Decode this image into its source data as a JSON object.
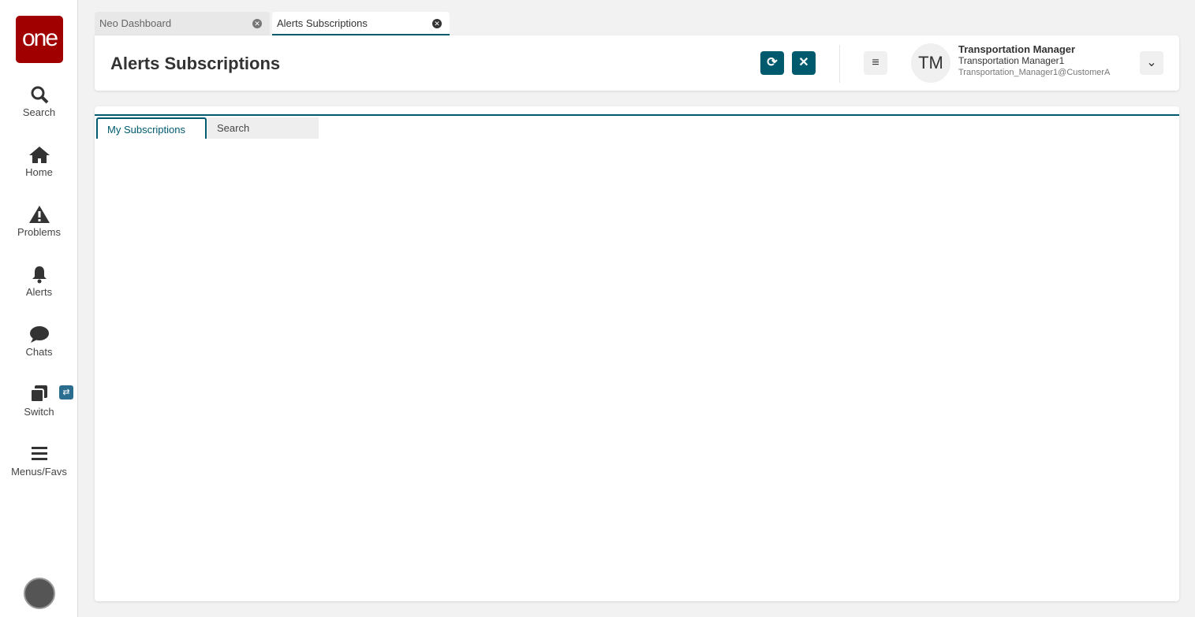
{
  "sidebar": {
    "logo": "one",
    "items": [
      {
        "label": "Search",
        "icon": "search-icon"
      },
      {
        "label": "Home",
        "icon": "home-icon"
      },
      {
        "label": "Problems",
        "icon": "warning-icon"
      },
      {
        "label": "Alerts",
        "icon": "bell-icon"
      },
      {
        "label": "Chats",
        "icon": "chat-icon"
      },
      {
        "label": "Switch",
        "icon": "switch-icon"
      },
      {
        "label": "Menus/Favs",
        "icon": "menu-icon"
      }
    ],
    "switch_badge": "⇄"
  },
  "tabs": [
    {
      "label": "Neo Dashboard"
    },
    {
      "label": "Alerts Subscriptions"
    }
  ],
  "header": {
    "title": "Alerts Subscriptions",
    "user_initials": "TM",
    "user_name": "Transportation Manager",
    "user_role": "Transportation Manager1",
    "user_email": "Transportation_Manager1@CustomerA"
  },
  "panel": {
    "tabs": [
      {
        "label": "My Subscriptions"
      },
      {
        "label": "Search"
      }
    ]
  },
  "colors": {
    "accent": "#005a6e",
    "logo": "#a00000"
  }
}
